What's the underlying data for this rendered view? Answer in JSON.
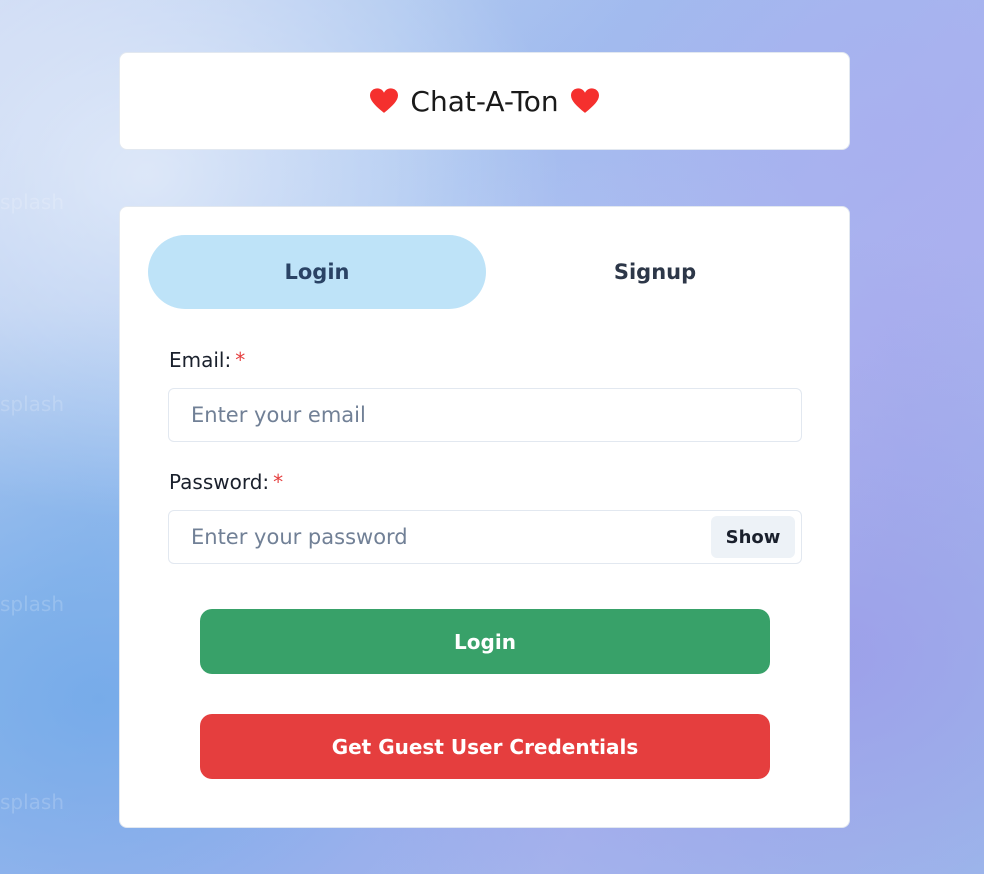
{
  "header": {
    "title": "Chat-A-Ton",
    "left_icon": "heart-icon",
    "right_icon": "heart-icon"
  },
  "tabs": [
    {
      "label": "Login",
      "active": true
    },
    {
      "label": "Signup",
      "active": false
    }
  ],
  "form": {
    "email": {
      "label": "Email:",
      "required_marker": "*",
      "placeholder": "Enter your email",
      "value": ""
    },
    "password": {
      "label": "Password:",
      "required_marker": "*",
      "placeholder": "Enter your password",
      "value": "",
      "toggle_label": "Show"
    },
    "login_label": "Login",
    "guest_label": "Get Guest User Credentials"
  },
  "colors": {
    "heart": "#f5302e",
    "active_tab": "#bee3f8",
    "login_button": "#38a169",
    "guest_button": "#e53e3e",
    "required_marker": "#e53e3e"
  }
}
